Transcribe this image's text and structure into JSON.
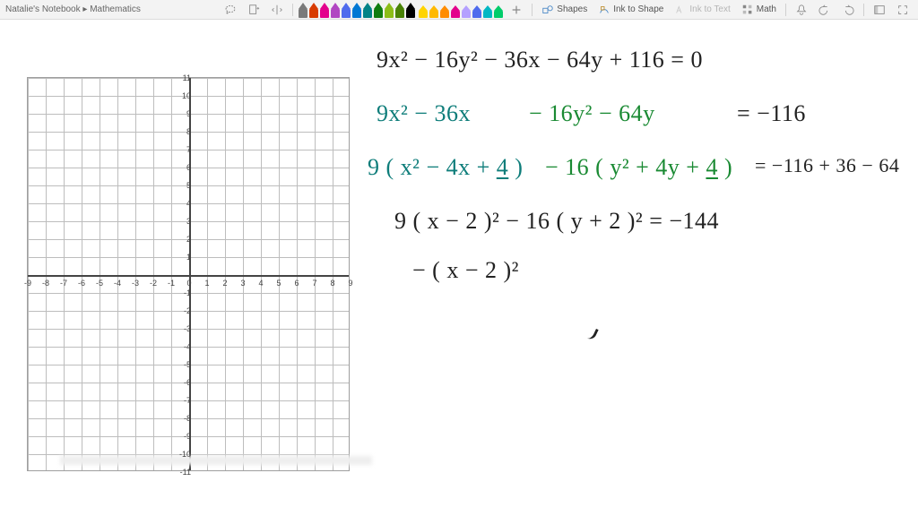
{
  "title": "Natalie's Notebook ▸ Mathematics",
  "toolbar": {
    "lasso": "Lasso",
    "add_page": "Add Page",
    "insert_space": "Insert Space",
    "shapes": "Shapes",
    "ink_to_shape": "Ink to Shape",
    "ink_to_text": "Ink to Text",
    "math": "Math"
  },
  "pen_colors": [
    "#7a7a7a",
    "#d83b01",
    "#e3008c",
    "#b146c2",
    "#4f6bed",
    "#0078d4",
    "#038387",
    "#107c10",
    "#8cbd18",
    "#498205",
    "#000000"
  ],
  "highlighters": [
    "#ffd400",
    "#ffb900",
    "#ff8c00",
    "#e3008c",
    "#b4a0ff",
    "#4f6bed",
    "#00b7c3",
    "#00cc6a"
  ],
  "graph": {
    "x_ticks": [
      "-9",
      "-8",
      "-7",
      "-6",
      "-5",
      "-4",
      "-3",
      "-2",
      "-1",
      "0",
      "1",
      "2",
      "3",
      "4",
      "5",
      "6",
      "7",
      "8",
      "9"
    ],
    "y_ticks_pos": [
      "1",
      "2",
      "3",
      "4",
      "5",
      "6",
      "7",
      "8",
      "9",
      "10",
      "11"
    ],
    "y_ticks_neg": [
      "-1",
      "-2",
      "-3",
      "-4",
      "-5",
      "-6",
      "-7",
      "-8",
      "-9",
      "-10",
      "-11"
    ]
  },
  "math": {
    "l1": "9x² − 16y² − 36x − 64y  + 116 = 0",
    "l2a": "9x² − 36x",
    "l2b": "− 16y² − 64y",
    "l2c": "= −116",
    "l3a": "9 ( x² − 4x + ",
    "l3a_u": "4",
    "l3a2": " )",
    "l3b": " − 16 ( y² + 4y + ",
    "l3b_u": "4",
    "l3b2": " )",
    "l3c": " = −116 + 36 − 64",
    "l4": "9 ( x − 2 )²  −  16 ( y + 2 )²  =  −144",
    "l5": "− ( x − 2 )²"
  }
}
